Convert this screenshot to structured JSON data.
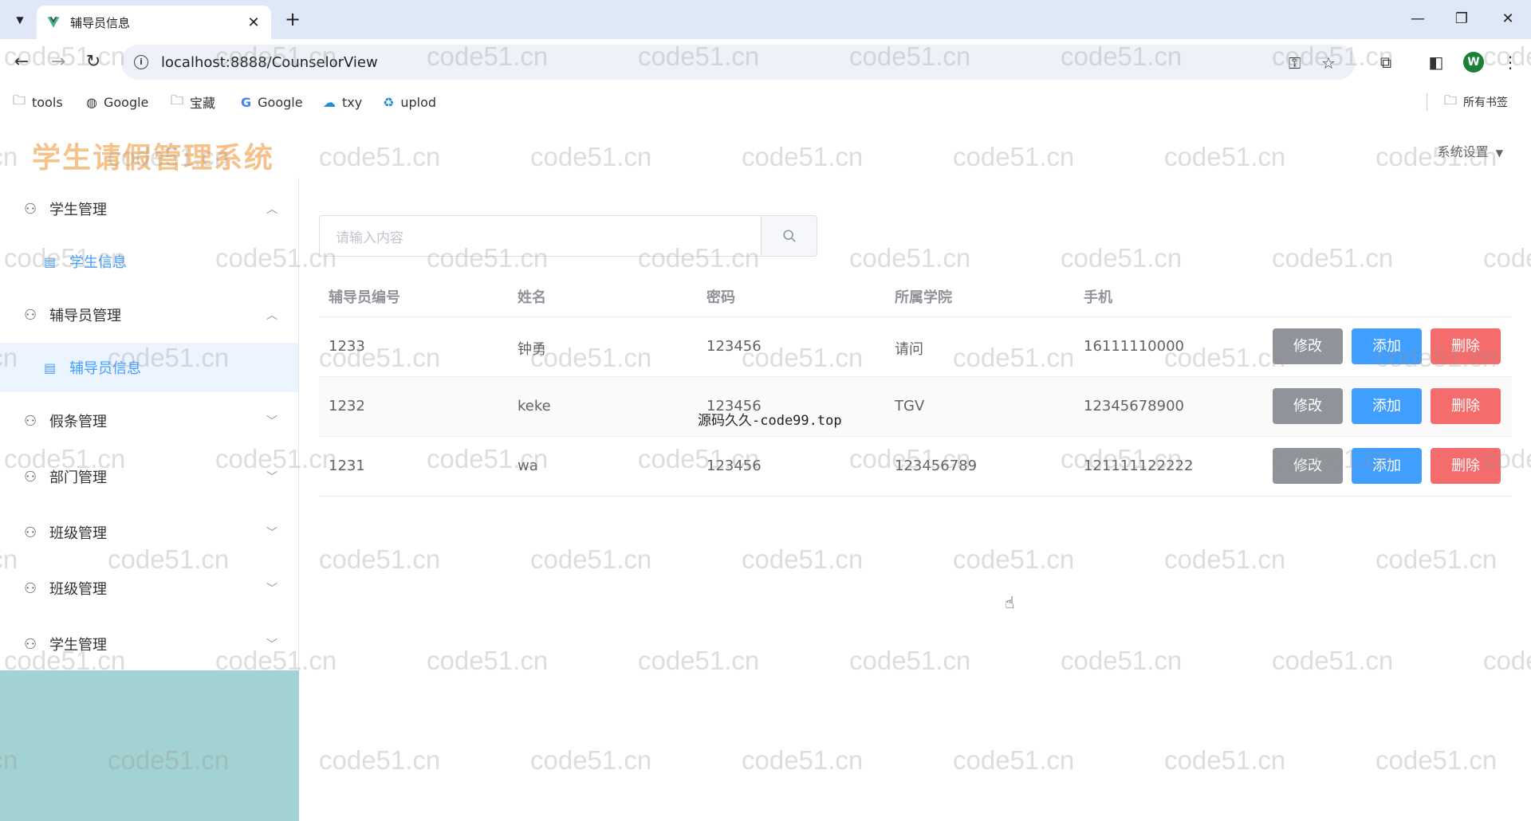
{
  "browser": {
    "tab_title": "辅导员信息",
    "url": "localhost:8888/CounselorView",
    "bookmarks": [
      "tools",
      "Google",
      "宝藏",
      "Google",
      "txy",
      "uplod"
    ],
    "all_bookmarks": "所有书签",
    "profile_initial": "W"
  },
  "app": {
    "title": "学生请假管理系统",
    "settings_label": "系统设置"
  },
  "sidebar": {
    "groups": [
      {
        "label": "学生管理",
        "expanded": true,
        "items": [
          "学生信息"
        ]
      },
      {
        "label": "辅导员管理",
        "expanded": true,
        "items": [
          "辅导员信息"
        ]
      },
      {
        "label": "假条管理",
        "expanded": false
      },
      {
        "label": "部门管理",
        "expanded": false
      },
      {
        "label": "班级管理",
        "expanded": false
      },
      {
        "label": "班级管理",
        "expanded": false
      },
      {
        "label": "学生管理",
        "expanded": false
      }
    ]
  },
  "search": {
    "placeholder": "请输入内容"
  },
  "table": {
    "headers": [
      "辅导员编号",
      "姓名",
      "密码",
      "所属学院",
      "手机"
    ],
    "rows": [
      [
        "1233",
        "钟勇",
        "123456",
        "请问",
        "16111110000"
      ],
      [
        "1232",
        "keke",
        "123456",
        "TGV",
        "12345678900"
      ],
      [
        "1231",
        "wa",
        "123456",
        "123456789",
        "121111122222"
      ]
    ],
    "actions": {
      "edit": "修改",
      "add": "添加",
      "delete": "删除"
    }
  },
  "overlay_text": "源码久久-code99.top",
  "watermark": "code51.cn",
  "colors": {
    "primary": "#409eff",
    "danger": "#f56c6c",
    "info": "#909399",
    "title": "#f5c28a",
    "sidebar_fill": "#a2d2d2"
  }
}
